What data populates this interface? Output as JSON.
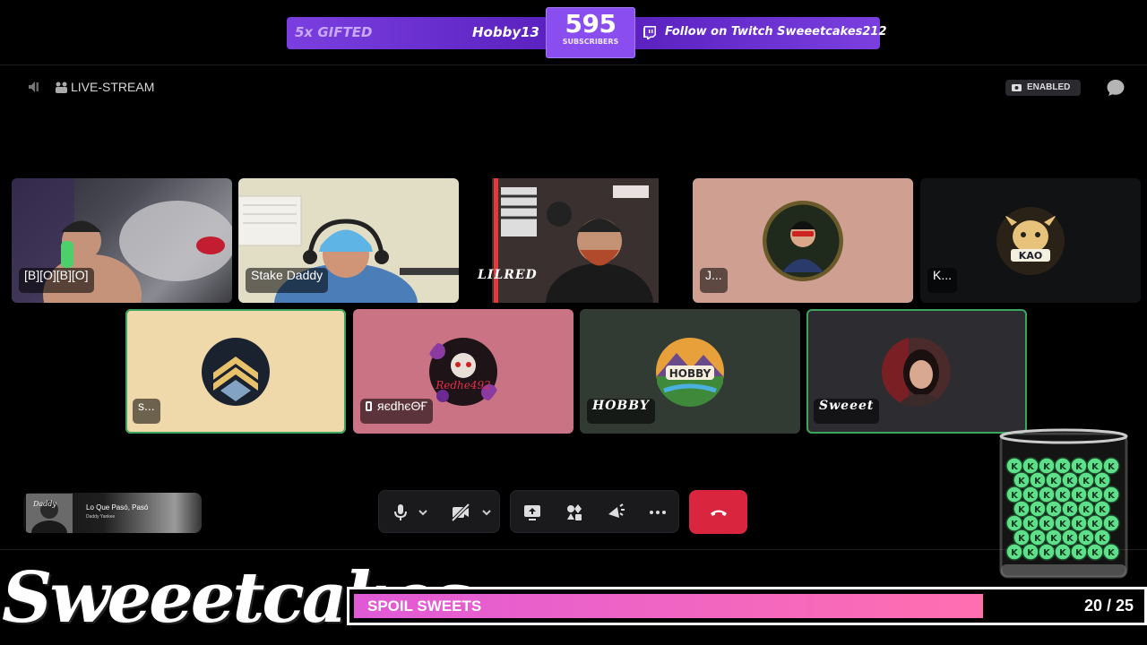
{
  "banner": {
    "gifted_label": "5x GIFTED",
    "gifter": "Hobby13",
    "subscriber_count": "595",
    "subscriber_label": "SUBSCRIBERS",
    "follow_text": "Follow on Twitch Sweeetcakes212"
  },
  "header": {
    "channel_title": "LIVE-STREAM",
    "enabled_badge": "ENABLED"
  },
  "tiles": [
    {
      "name": "[B][O][B][O]",
      "type": "video"
    },
    {
      "name": "Stake Daddy",
      "type": "video"
    },
    {
      "name": "LILRED",
      "type": "video"
    },
    {
      "name": "J...",
      "type": "avatar",
      "bg": "#cfa092"
    },
    {
      "name": "K...",
      "type": "avatar",
      "bg": "#111214"
    },
    {
      "name": "s...",
      "type": "avatar",
      "bg": "#efd9ab",
      "speaking": true
    },
    {
      "name": "яєdhєΘҒ",
      "type": "avatar",
      "bg": "#c97384",
      "mobile": true
    },
    {
      "name": "HOBBY",
      "type": "avatar",
      "bg": "#313a33"
    },
    {
      "name": "Sweeet",
      "type": "avatar",
      "bg": "#2d2d31",
      "speaking": true
    }
  ],
  "now_playing": {
    "title": "Lo Que Pasó, Pasó",
    "artist": "Daddy Yankee"
  },
  "overlay": {
    "logo_text": "Sweeetcakes",
    "goal_label": "SPOIL SWEETS",
    "goal_count": "20 / 25",
    "goal_current": 20,
    "goal_target": 25
  },
  "colors": {
    "accent_purple": "#7b3fe0",
    "speaking_green": "#3ba55d",
    "hangup_red": "#d9263e",
    "goal_pink": "#ff6fb0"
  },
  "icons": {
    "voice": "voice-channel-icon",
    "mic": "microphone-icon",
    "camera_off": "camera-off-icon",
    "screen_share": "screen-share-icon",
    "activities": "activities-icon",
    "soundboard": "soundboard-icon",
    "more": "more-icon",
    "hangup": "hang-up-icon",
    "chat": "chat-icon"
  }
}
